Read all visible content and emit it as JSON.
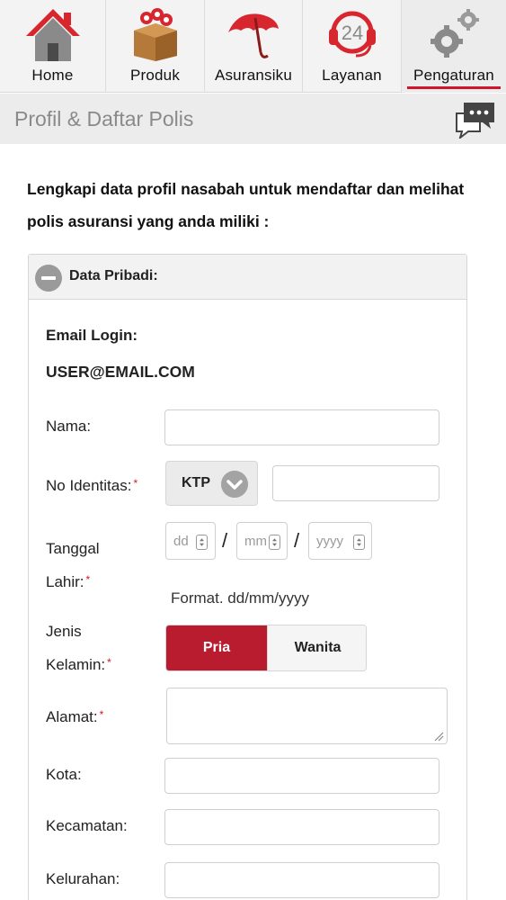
{
  "nav": {
    "items": [
      {
        "label": "Home",
        "icon": "house-icon"
      },
      {
        "label": "Produk",
        "icon": "box-icon"
      },
      {
        "label": "Asuransiku",
        "icon": "umbrella-icon"
      },
      {
        "label": "Layanan",
        "icon": "headset-24-icon"
      },
      {
        "label": "Pengaturan",
        "icon": "gears-icon",
        "active": true
      }
    ],
    "active_color": "#d0142c"
  },
  "header": {
    "title": "Profil & Daftar Polis",
    "chat_icon": "chat-bubble-icon"
  },
  "intro": "Lengkapi data profil nasabah untuk mendaftar dan melihat polis asuransi yang anda miliki :",
  "panel": {
    "title": "Data Pribadi:",
    "email_label": "Email Login:",
    "email_value": "USER@EMAIL.COM",
    "fields": {
      "nama": {
        "label": "Nama:",
        "value": ""
      },
      "no_identitas": {
        "label": "No Identitas:",
        "type_value": "KTP",
        "value": ""
      },
      "tanggal_lahir": {
        "label_line1": "Tanggal",
        "label_line2": "Lahir:",
        "dd_placeholder": "dd",
        "mm_placeholder": "mm",
        "yyyy_placeholder": "yyyy",
        "separator": "/",
        "format_hint": "Format. dd/mm/yyyy"
      },
      "jenis_kelamin": {
        "label_line1": "Jenis",
        "label_line2": "Kelamin:",
        "options": [
          "Pria",
          "Wanita"
        ],
        "selected": "Pria"
      },
      "alamat": {
        "label": "Alamat:",
        "value": ""
      },
      "kota": {
        "label": "Kota:",
        "value": ""
      },
      "kecamatan": {
        "label": "Kecamatan:",
        "value": ""
      },
      "kelurahan": {
        "label": "Kelurahan:",
        "value": ""
      }
    },
    "required_mark": "*"
  },
  "colors": {
    "brand_red": "#b81c2e",
    "required_red": "#d0142c",
    "header_bg": "#ececec"
  }
}
